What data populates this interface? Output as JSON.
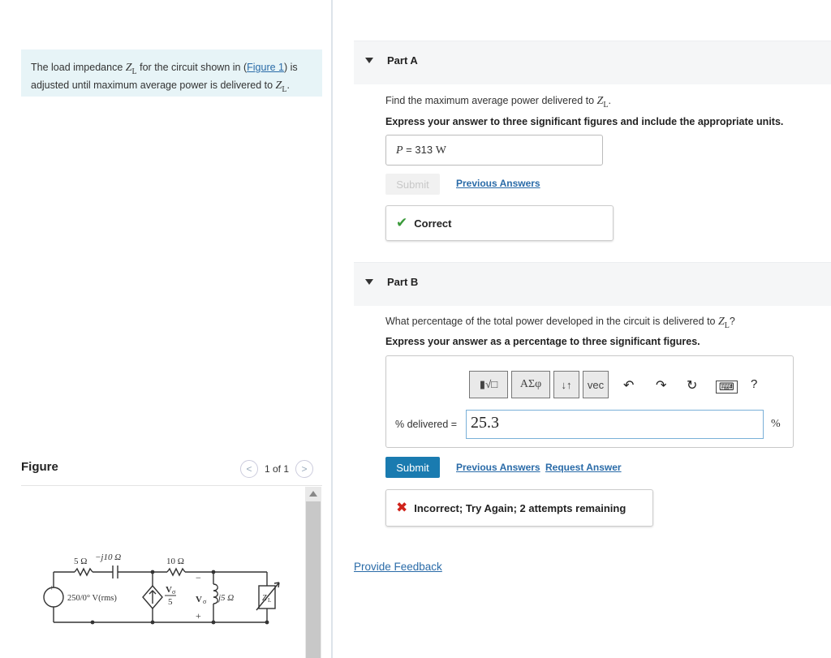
{
  "problem": {
    "text_before": "The load impedance ",
    "zl": "Z",
    "zl_sub": "L",
    "text_mid": " for the circuit shown in (",
    "figure_link": "Figure 1",
    "text_mid2": ") is adjusted until maximum average power is delivered to ",
    "text_end": "."
  },
  "figure": {
    "label": "Figure",
    "pager": "1 of 1",
    "prev_icon": "chevron-left-icon",
    "next_icon": "chevron-right-icon",
    "circuit": {
      "r1": "5 Ω",
      "c1": "−j10 Ω",
      "r2": "10 Ω",
      "source": "250/0° V(rms)",
      "dep_num": "V",
      "dep_sub": "σ",
      "dep_den": "5",
      "v_label": "V",
      "v_sub": "σ",
      "inductor": "j5 Ω",
      "zl": "Z",
      "zl_sub": "L",
      "minus": "−",
      "plus": "+"
    }
  },
  "partA": {
    "title": "Part A",
    "question": "Find the maximum average power delivered to ",
    "question_end": ".",
    "instruction": "Express your answer to three significant figures and include the appropriate units.",
    "answer_label": "P",
    "answer_eq": " = ",
    "answer_value": "313",
    "answer_unit": "W",
    "submit": "Submit",
    "previous_answers": "Previous Answers",
    "result": "Correct"
  },
  "partB": {
    "title": "Part B",
    "question": "What percentage of the total power developed in the circuit is delivered to ",
    "question_end": "?",
    "instruction": "Express your answer as a percentage to three significant figures.",
    "toolbar": {
      "templates": "▮√□",
      "greek": "ΑΣφ",
      "arrows": "↓↑",
      "vec": "vec"
    },
    "answer_label": "% delivered =",
    "answer_value": "25.3",
    "unit": "%",
    "submit": "Submit",
    "previous_answers": "Previous Answers",
    "request_answer": "Request Answer",
    "result": "Incorrect; Try Again; 2 attempts remaining",
    "help": "?"
  },
  "feedback": "Provide Feedback",
  "colors": {
    "accent": "#1a7bb0",
    "link": "#2a6ba8",
    "correct": "#3a9a3a",
    "incorrect": "#d0231b",
    "problem_bg": "#e7f4f7"
  }
}
